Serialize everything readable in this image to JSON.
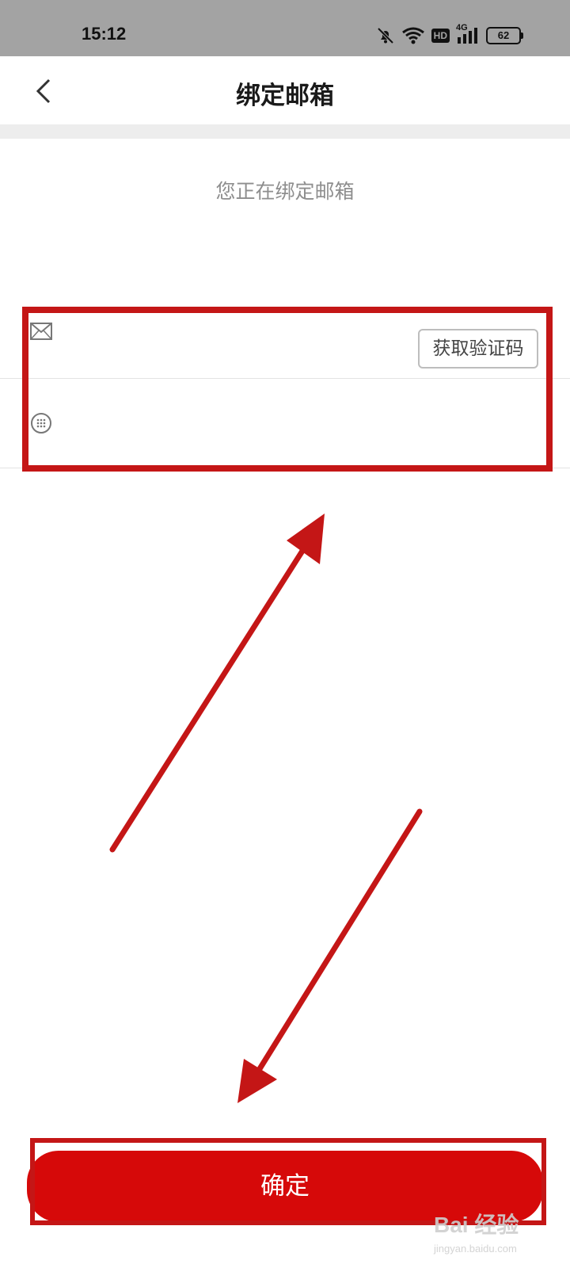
{
  "status_bar": {
    "time": "15:12",
    "icons": [
      "bell-muted-icon",
      "wifi-icon",
      "hd-icon",
      "signal-4g-icon",
      "battery-icon"
    ],
    "hd_label": "HD",
    "network_label": "4G",
    "battery_level": "62"
  },
  "header": {
    "title": "绑定邮箱",
    "back_icon": "chevron-left-icon"
  },
  "subtitle": "您正在绑定邮箱",
  "form": {
    "email_icon": "envelope-icon",
    "email_value": "",
    "get_code_label": "获取验证码",
    "code_icon": "keypad-icon",
    "code_value": ""
  },
  "confirm_label": "确定",
  "watermark": {
    "main": "Bai 经验",
    "sub": "jingyan.baidu.com"
  },
  "colors": {
    "accent": "#d60909",
    "annotation": "#c41616",
    "status_bar_bg": "#a3a3a3"
  }
}
